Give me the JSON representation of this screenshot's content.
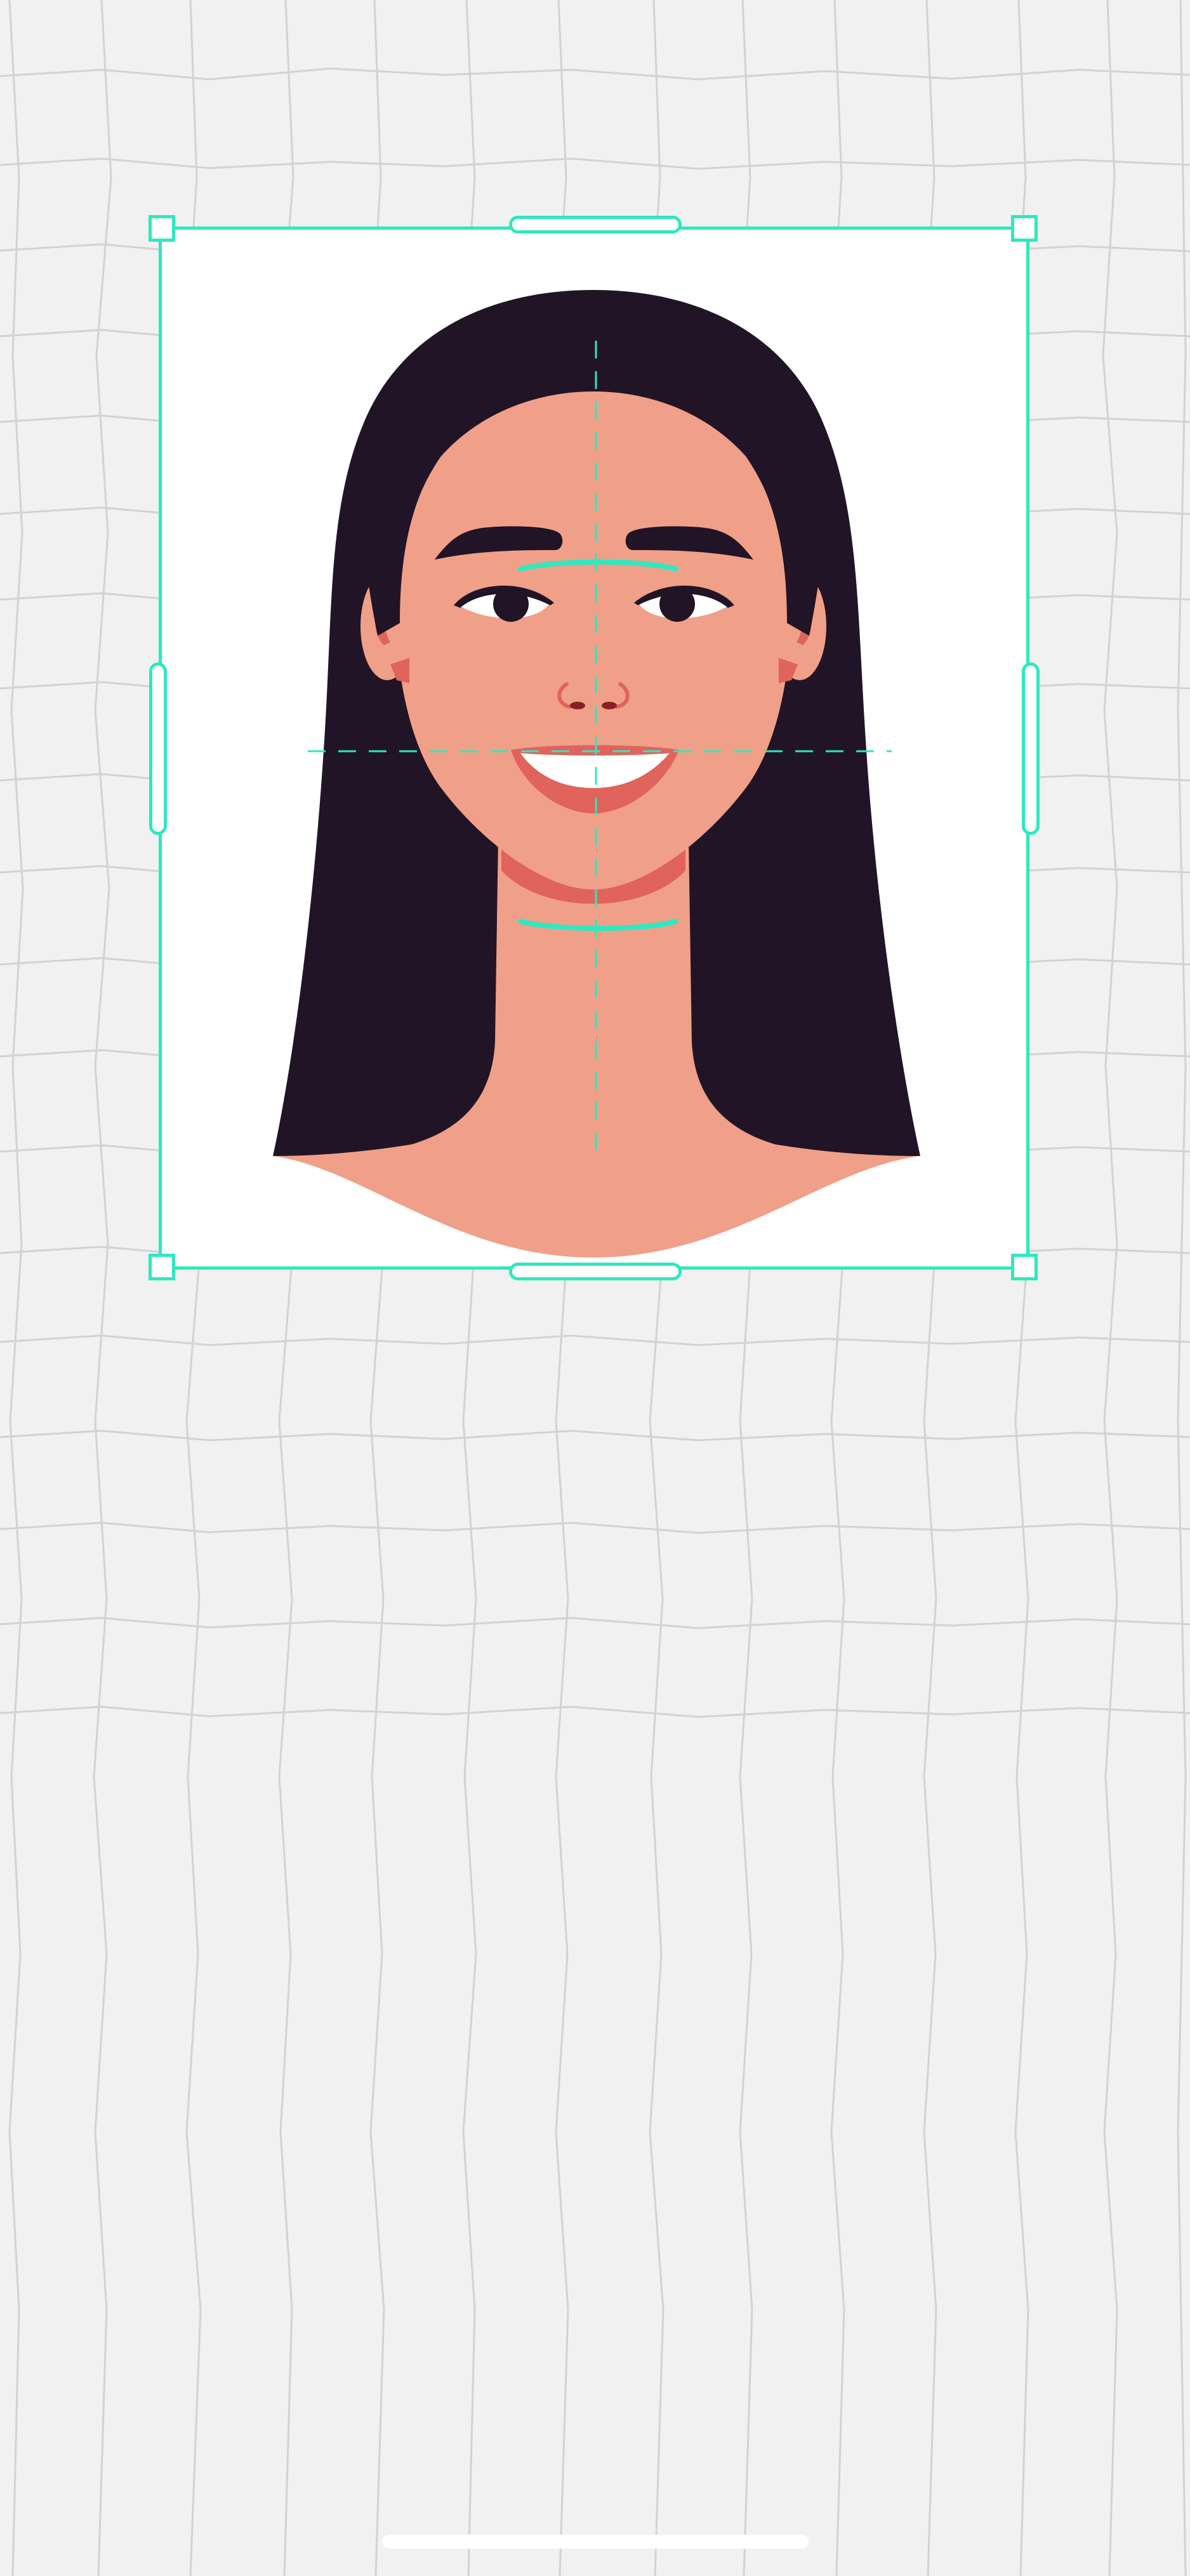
{
  "editor": {
    "mode": "passport-photo-crop",
    "guide_color": "#2ee8c0"
  },
  "portrait": {
    "subject": "woman-with-long-dark-hair-smiling",
    "hair_color": "#211427",
    "skin_color": "#f0a088",
    "accent_color": "#e0635c"
  },
  "icons": {
    "corner_handle": "square-handle-icon",
    "edge_handle": "pill-handle-icon"
  }
}
